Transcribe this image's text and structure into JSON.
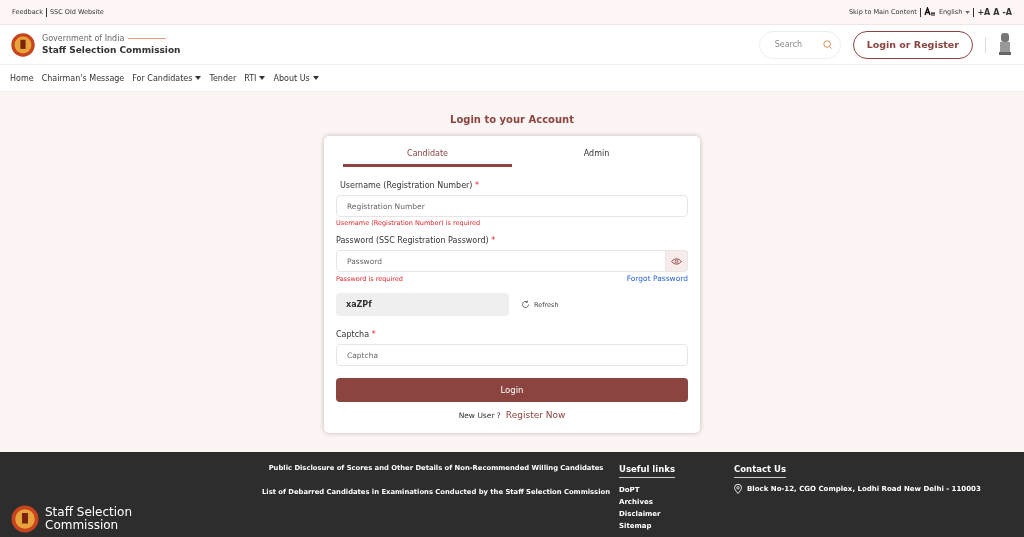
{
  "top_bar": {
    "left_links": [
      "Feedback",
      "SSC Old Website"
    ],
    "skip_link": "Skip to Main Content",
    "language": "English",
    "font_sizes": [
      "+A",
      "A",
      "-A"
    ]
  },
  "header": {
    "subtitle": "Government of India",
    "title": "Staff Selection Commission",
    "search": {
      "placeholder": "Search"
    },
    "login_button": "Login or Register"
  },
  "nav": [
    {
      "label": "Home",
      "dropdown": false
    },
    {
      "label": "Chairman's Message",
      "dropdown": false
    },
    {
      "label": "For Candidates",
      "dropdown": true
    },
    {
      "label": "Tender",
      "dropdown": false
    },
    {
      "label": "RTI",
      "dropdown": true
    },
    {
      "label": "About Us",
      "dropdown": true
    }
  ],
  "login": {
    "title": "Login to your Account",
    "tabs": [
      {
        "label": "Candidate",
        "selected": true
      },
      {
        "label": "Admin",
        "selected": false
      }
    ],
    "username": {
      "label": "Username (Registration Number)",
      "mark": "*",
      "placeholder": "Registration Number",
      "error": "Username (Registration Number) is required"
    },
    "password": {
      "label": "Password (SSC Registration Password)",
      "mark": "*",
      "placeholder": "Password",
      "error": "Password is required",
      "forgot": "Forgot Password"
    },
    "captcha_image": "xaZPf",
    "refresh": "Refresh",
    "captcha": {
      "label": "Captcha",
      "mark": "*",
      "placeholder": "Captcha"
    },
    "submit": "Login",
    "new_user": "New User ?",
    "register": "Register Now"
  },
  "footer": {
    "brand": [
      "Staff Selection",
      "Commission"
    ],
    "notices": [
      "Public Disclosure of Scores and Other Details of Non-Recommended Willing Candidates",
      "List of Debarred Candidates in Examinations Conducted by the Staff Selection Commission"
    ],
    "useful_links": {
      "title": "Useful links",
      "items": [
        "DoPT",
        "Archives",
        "Disclaimer",
        "Sitemap"
      ]
    },
    "contact": {
      "title": "Contact Us",
      "address": "Block No-12, CGO Complex, Lodhi Road New Delhi - 110003"
    }
  }
}
